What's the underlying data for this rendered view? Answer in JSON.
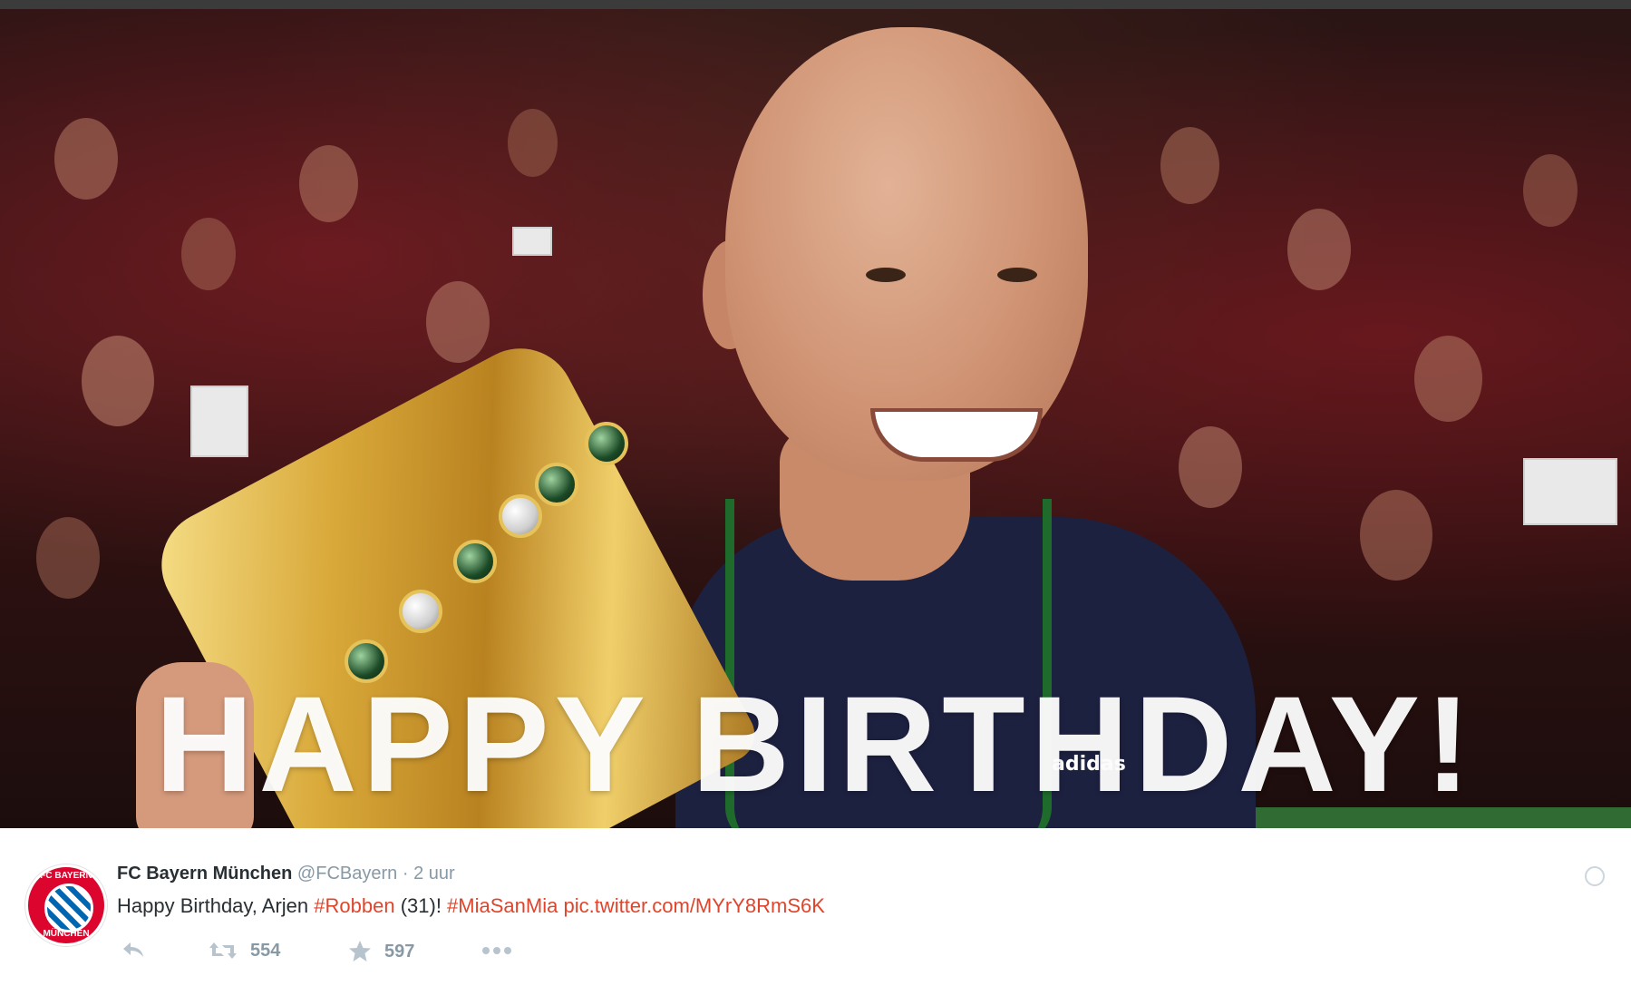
{
  "media": {
    "headline": "HAPPY BIRTHDAY!",
    "jersey_brand": "adidas",
    "colors": {
      "crowd": "#3a1616",
      "jersey": "#1d2140",
      "trophy": "#d9a93a",
      "lanyard": "#1f6b2c"
    }
  },
  "tweet": {
    "avatar_text_top": "FC BAYERN",
    "avatar_text_bottom": "MÜNCHEN",
    "author_name": "FC Bayern München",
    "author_handle": "@FCBayern",
    "separator": "·",
    "time": "2 uur",
    "text_prefix": "Happy Birthday, Arjen ",
    "hashtag_1": "#Robben",
    "text_middle": " (31)! ",
    "hashtag_2": "#MiaSanMia",
    "text_space": " ",
    "link": "pic.twitter.com/MYrY8RmS6K",
    "retweet_count": "554",
    "favorite_count": "597",
    "colors": {
      "name": "#292f33",
      "meta": "#8899a6",
      "link": "#e0452b",
      "brand_red": "#dc052d"
    }
  }
}
